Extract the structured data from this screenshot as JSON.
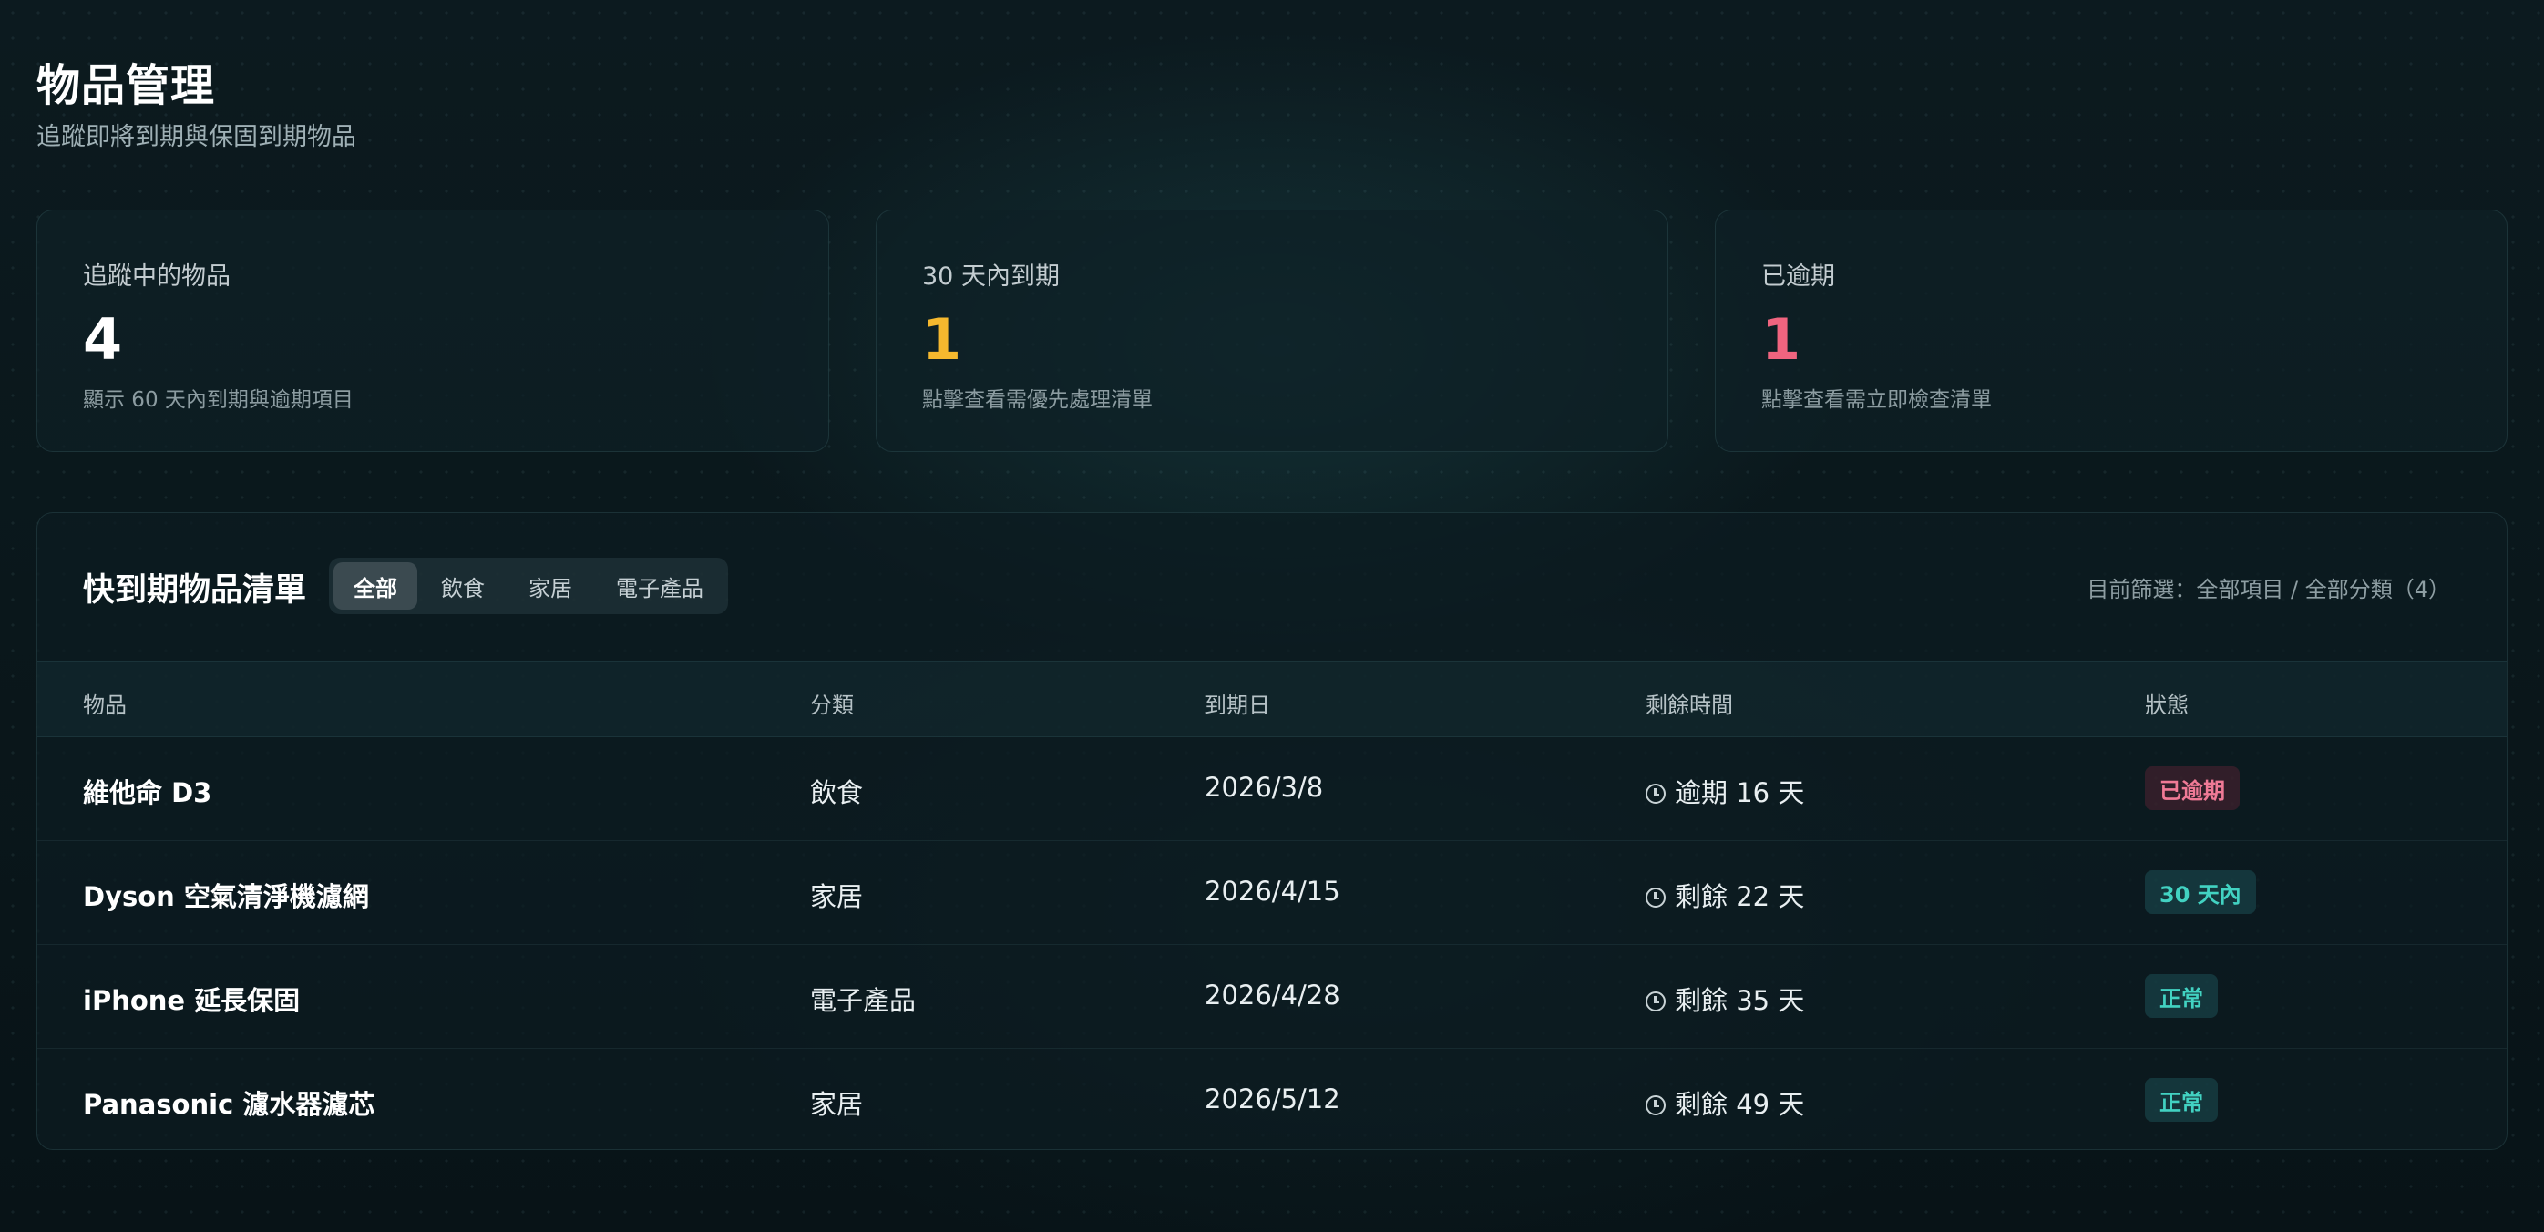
{
  "header": {
    "title": "物品管理",
    "subtitle": "追蹤即將到期與保固到期物品"
  },
  "stats": [
    {
      "label": "追蹤中的物品",
      "value": "4",
      "desc": "顯示 60 天內到期與逾期項目",
      "color": "#ffffff"
    },
    {
      "label": "30 天內到期",
      "value": "1",
      "desc": "點擊查看需優先處理清單",
      "color": "#f5b82e"
    },
    {
      "label": "已逾期",
      "value": "1",
      "desc": "點擊查看需立即檢查清單",
      "color": "#f0647f"
    }
  ],
  "panel": {
    "title": "快到期物品清單",
    "tabs": [
      "全部",
      "飲食",
      "家居",
      "電子產品"
    ],
    "active_tab": "全部",
    "filter_status": "目前篩選：全部項目 / 全部分類（4）"
  },
  "table": {
    "columns": [
      "物品",
      "分類",
      "到期日",
      "剩餘時間",
      "狀態"
    ],
    "rows": [
      {
        "name": "維他命 D3",
        "category": "飲食",
        "date": "2026/3/8",
        "remaining": "逾期 16 天",
        "status": "已逾期"
      },
      {
        "name": "Dyson 空氣清淨機濾網",
        "category": "家居",
        "date": "2026/4/15",
        "remaining": "剩餘 22 天",
        "status": "30 天內"
      },
      {
        "name": "iPhone 延長保固",
        "category": "電子產品",
        "date": "2026/4/28",
        "remaining": "剩餘 35 天",
        "status": "正常"
      },
      {
        "name": "Panasonic 濾水器濾芯",
        "category": "家居",
        "date": "2026/5/12",
        "remaining": "剩餘 49 天",
        "status": "正常"
      }
    ]
  },
  "icons": {
    "remaining": "clock-icon"
  },
  "colors": {
    "overdue": "#f07a96",
    "soon": "#42d2c2",
    "normal": "#42d2c2",
    "accent_yellow": "#f5b82e",
    "accent_pink": "#f0647f"
  }
}
